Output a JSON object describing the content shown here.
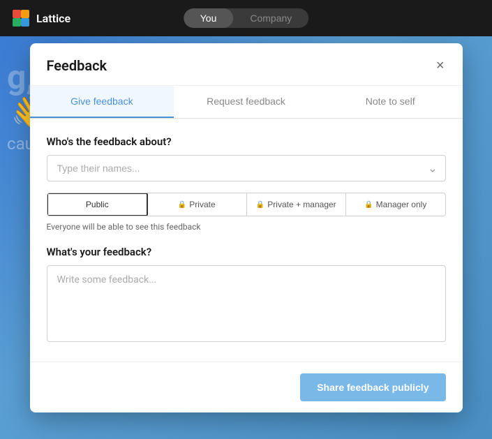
{
  "nav": {
    "logo_text": "Lattice",
    "toggle": {
      "you_label": "You",
      "company_label": "Company"
    }
  },
  "background": {
    "text1": "g,",
    "emoji": "👋",
    "text2": "caught"
  },
  "modal": {
    "title": "Feedback",
    "close_label": "×",
    "tabs": [
      {
        "id": "give",
        "label": "Give feedback",
        "active": true
      },
      {
        "id": "request",
        "label": "Request feedback",
        "active": false
      },
      {
        "id": "note",
        "label": "Note to self",
        "active": false
      }
    ],
    "who_label": "Who's the feedback about?",
    "who_placeholder": "Type their names...",
    "visibility": {
      "options": [
        {
          "id": "public",
          "label": "Public",
          "lock": false,
          "active": true
        },
        {
          "id": "private",
          "label": "Private",
          "lock": true,
          "active": false
        },
        {
          "id": "private-manager",
          "label": "Private + manager",
          "lock": true,
          "active": false
        },
        {
          "id": "manager-only",
          "label": "Manager only",
          "lock": true,
          "active": false
        }
      ],
      "hint": "Everyone will be able to see this feedback"
    },
    "feedback_label": "What's your feedback?",
    "feedback_placeholder": "Write some feedback...",
    "submit_label": "Share feedback publicly"
  }
}
